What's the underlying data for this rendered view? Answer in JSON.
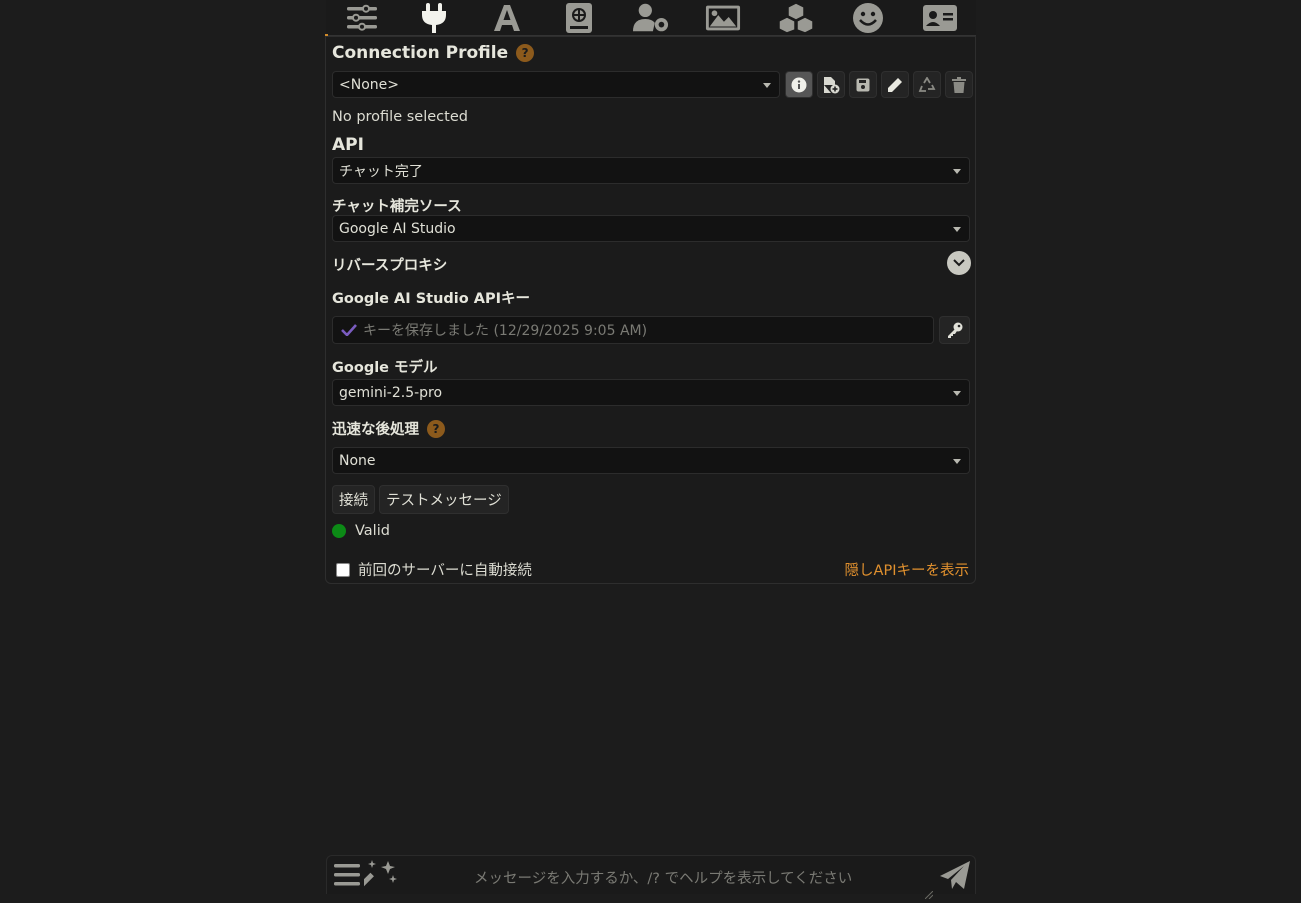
{
  "nav": {
    "icons": [
      "sliders-icon",
      "plug-icon",
      "font-a-icon",
      "book-globe-icon",
      "user-gear-icon",
      "image-icon",
      "cubes-icon",
      "smile-icon",
      "id-card-icon"
    ]
  },
  "connection_profile": {
    "title": "Connection Profile",
    "help": "?",
    "selected": "<None>",
    "status_text": "No profile selected",
    "toolbar_icons": [
      "info-icon",
      "file-add-icon",
      "save-icon",
      "pencil-icon",
      "recycle-icon",
      "trash-icon"
    ]
  },
  "api": {
    "label": "API",
    "selected": "チャット完了"
  },
  "chat_source": {
    "label": "チャット補完ソース",
    "selected": "Google AI Studio"
  },
  "reverse_proxy": {
    "label": "リバースプロキシ"
  },
  "api_key": {
    "label": "Google AI Studio APIキー",
    "placeholder": "キーを保存しました (12/29/2025 9:05 AM)"
  },
  "model": {
    "label": "Google モデル",
    "selected": "gemini-2.5-pro"
  },
  "postprocess": {
    "label": "迅速な後処理",
    "help": "?",
    "selected": "None"
  },
  "actions": {
    "connect": "接続",
    "test_message": "テストメッセージ"
  },
  "status": {
    "text": "Valid",
    "color": "#0c8a16"
  },
  "auto_connect": {
    "label": "前回のサーバーに自動接続",
    "checked": false
  },
  "show_hidden_keys": "隠しAPIキーを表示",
  "composer": {
    "placeholder": "メッセージを入力するか、/? でヘルプを表示してください"
  },
  "colors": {
    "accent": "#e0902e",
    "help_badge": "#8c5a1c",
    "background": "#1c1c1c",
    "panel": "#1b1b1b",
    "check": "#7a5cc0"
  }
}
